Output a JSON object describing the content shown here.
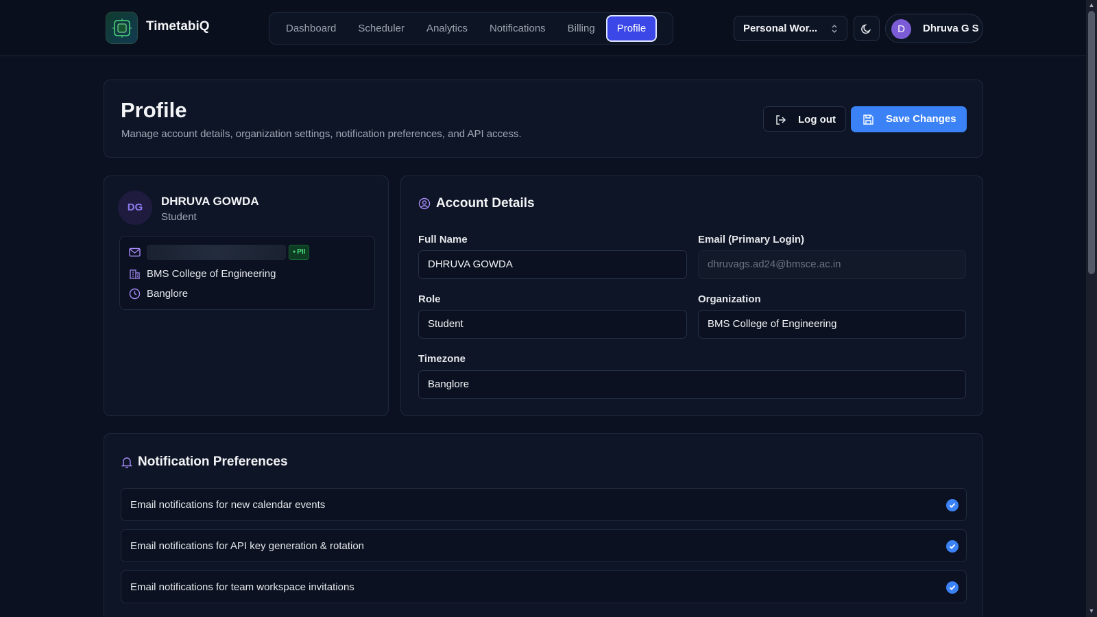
{
  "app": {
    "brand": "TimetabiQ"
  },
  "nav": {
    "items": [
      {
        "label": "Dashboard"
      },
      {
        "label": "Scheduler"
      },
      {
        "label": "Analytics"
      },
      {
        "label": "Notifications"
      },
      {
        "label": "Billing"
      },
      {
        "label": "Profile",
        "active": true
      }
    ]
  },
  "workspace": {
    "label": "Personal Wor..."
  },
  "user": {
    "initial": "D",
    "name": "Dhruva G S"
  },
  "header": {
    "title": "Profile",
    "subtitle": "Manage account details, organization settings, notification preferences, and API access.",
    "logout_label": "Log out",
    "save_label": "Save Changes"
  },
  "summary": {
    "initials": "DG",
    "name": "DHRUVA GOWDA",
    "role": "Student",
    "pii_badge": "PII",
    "organization": "BMS College of Engineering",
    "timezone": "Banglore"
  },
  "account": {
    "title": "Account Details",
    "full_name_label": "Full Name",
    "full_name": "DHRUVA GOWDA",
    "email_label": "Email (Primary Login)",
    "email": "dhruvags.ad24@bmsce.ac.in",
    "role_label": "Role",
    "role": "Student",
    "org_label": "Organization",
    "org": "BMS College of Engineering",
    "tz_label": "Timezone",
    "tz": "Banglore"
  },
  "notifications": {
    "title": "Notification Preferences",
    "prefs": [
      {
        "label": "Email notifications for new calendar events",
        "checked": true
      },
      {
        "label": "Email notifications for API key generation & rotation",
        "checked": true
      },
      {
        "label": "Email notifications for team workspace invitations",
        "checked": true
      }
    ]
  },
  "colors": {
    "accent": "#3b82f6",
    "active_nav": "#3b47e6",
    "avatar": "#7c5cd6",
    "pii": "#4ade80"
  }
}
